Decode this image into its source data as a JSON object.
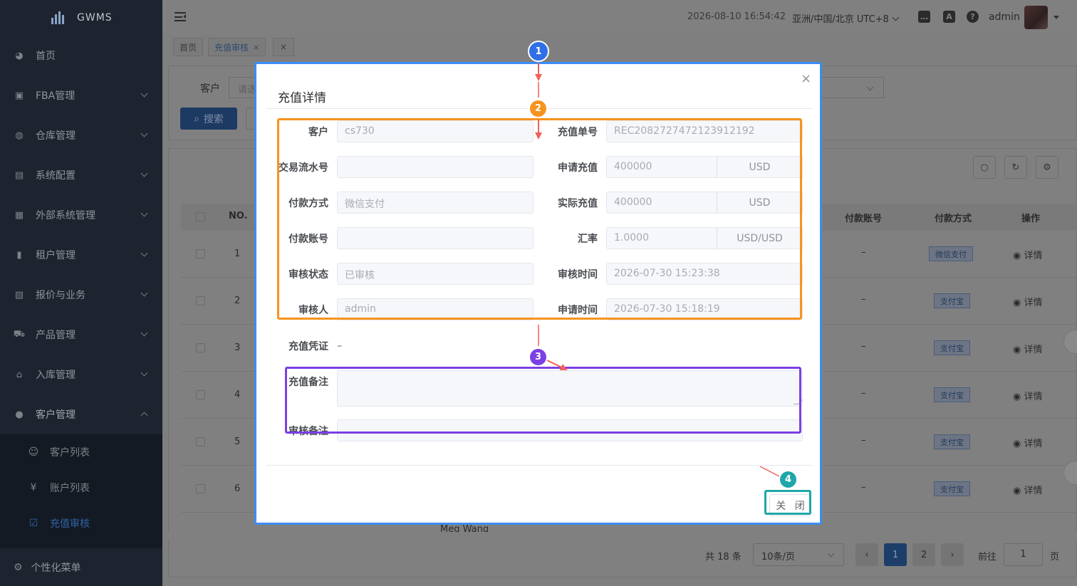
{
  "app": {
    "name": "GWMS"
  },
  "sidebar": {
    "items": [
      {
        "label": "首页",
        "icon": "dashboard-icon"
      },
      {
        "label": "FBA管理",
        "icon": "cube-icon"
      },
      {
        "label": "仓库管理",
        "icon": "warehouse-icon"
      },
      {
        "label": "系统配置",
        "icon": "config-icon"
      },
      {
        "label": "外部系统管理",
        "icon": "grid-icon"
      },
      {
        "label": "租户管理",
        "icon": "chart-icon"
      },
      {
        "label": "报价与业务",
        "icon": "document-icon"
      },
      {
        "label": "产品管理",
        "icon": "cart-icon"
      },
      {
        "label": "入库管理",
        "icon": "home-icon"
      },
      {
        "label": "客户管理",
        "icon": "user-icon"
      }
    ],
    "submenu": [
      {
        "label": "客户列表",
        "icon": "customer-icon"
      },
      {
        "label": "账户列表",
        "icon": "yen-icon"
      },
      {
        "label": "充值审核",
        "icon": "check-square-icon",
        "active": true
      }
    ],
    "custom_menu": "个性化菜单"
  },
  "header": {
    "datetime": "2026-08-10 16:54:42",
    "timezone": "亚洲/中国/北京 UTC+8",
    "username": "admin"
  },
  "tabs": [
    {
      "label": "首页"
    },
    {
      "label": "充值审核",
      "active": true
    }
  ],
  "filters": {
    "customer_label": "客户",
    "customer_placeholder": "请选",
    "search_button": "搜索"
  },
  "table": {
    "columns": {
      "no": "NO.",
      "account": "付款账号",
      "method": "付款方式",
      "ops": "操作"
    },
    "rows": [
      {
        "no": "1",
        "account": "–",
        "method": "微信支付",
        "action": "详情"
      },
      {
        "no": "2",
        "account": "–",
        "method": "支付宝",
        "action": "详情"
      },
      {
        "no": "3",
        "account": "–",
        "method": "支付宝",
        "action": "详情"
      },
      {
        "no": "4",
        "account": "–",
        "method": "支付宝",
        "action": "详情"
      },
      {
        "no": "5",
        "account": "–",
        "method": "支付宝",
        "action": "详情"
      },
      {
        "no": "6",
        "account": "–",
        "method": "支付宝",
        "action": "详情"
      }
    ],
    "partial_row_name": "Meg Wang"
  },
  "pagination": {
    "total": "共 18 条",
    "page_size": "10条/页",
    "pages": [
      "1",
      "2"
    ],
    "goto_label": "前往",
    "goto_value": "1",
    "page_suffix": "页"
  },
  "dialog": {
    "title": "充值详情",
    "fields": {
      "customer": {
        "label": "客户",
        "value": "cs730"
      },
      "order_no": {
        "label": "充值单号",
        "value": "REC2082727472123912192"
      },
      "txn_no": {
        "label": "交易流水号",
        "value": ""
      },
      "apply_amount": {
        "label": "申请充值",
        "value": "400000",
        "unit": "USD"
      },
      "pay_method": {
        "label": "付款方式",
        "value": "微信支付"
      },
      "actual_amount": {
        "label": "实际充值",
        "value": "400000",
        "unit": "USD"
      },
      "pay_account": {
        "label": "付款账号",
        "value": ""
      },
      "rate": {
        "label": "汇率",
        "value": "1.0000",
        "unit": "USD/USD"
      },
      "audit_status": {
        "label": "审核状态",
        "value": "已审核"
      },
      "audit_time": {
        "label": "审核时间",
        "value": "2026-07-30 15:23:38"
      },
      "auditor": {
        "label": "审核人",
        "value": "admin"
      },
      "apply_time": {
        "label": "申请时间",
        "value": "2026-07-30 15:18:19"
      },
      "voucher": {
        "label": "充值凭证",
        "value": "–"
      },
      "remark": {
        "label": "充值备注",
        "value": ""
      },
      "audit_remark": {
        "label": "审核备注",
        "value": ""
      }
    },
    "close_button": "关 闭"
  },
  "annotations": [
    {
      "num": "1",
      "color": "#2f6fe8"
    },
    {
      "num": "2",
      "color": "#f7931e"
    },
    {
      "num": "3",
      "color": "#7b3fe4"
    },
    {
      "num": "4",
      "color": "#1fa7a8"
    }
  ]
}
